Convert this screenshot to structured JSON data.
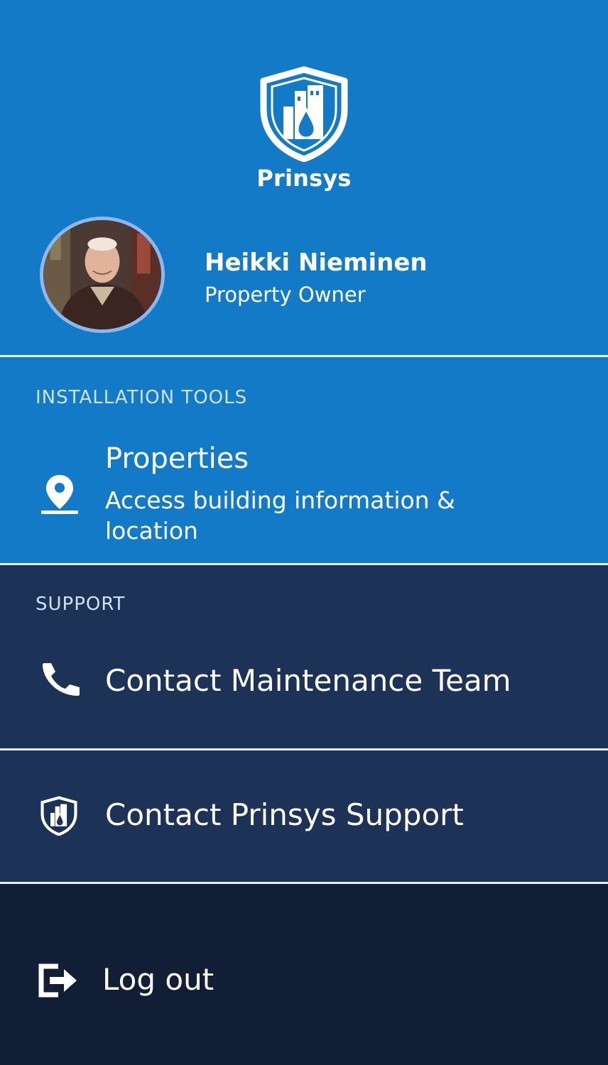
{
  "brand": {
    "name": "Prinsys"
  },
  "user": {
    "name": "Heikki Nieminen",
    "role": "Property Owner"
  },
  "sections": {
    "installation_tools": {
      "label": "INSTALLATION TOOLS",
      "items": [
        {
          "title": "Properties",
          "description": "Access building information & location",
          "icon": "location-pin-icon"
        }
      ]
    },
    "support": {
      "label": "SUPPORT",
      "items": [
        {
          "label": "Contact Maintenance Team",
          "icon": "phone-icon"
        },
        {
          "label": "Contact Prinsys Support",
          "icon": "prinsys-shield-icon"
        }
      ]
    }
  },
  "logout": {
    "label": "Log out",
    "icon": "logout-icon"
  },
  "colors": {
    "header_blue": "#137ac8",
    "support_navy": "#1d3257",
    "logout_navy": "#111e36",
    "divider": "#e6eef7",
    "text": "#ffffff"
  }
}
